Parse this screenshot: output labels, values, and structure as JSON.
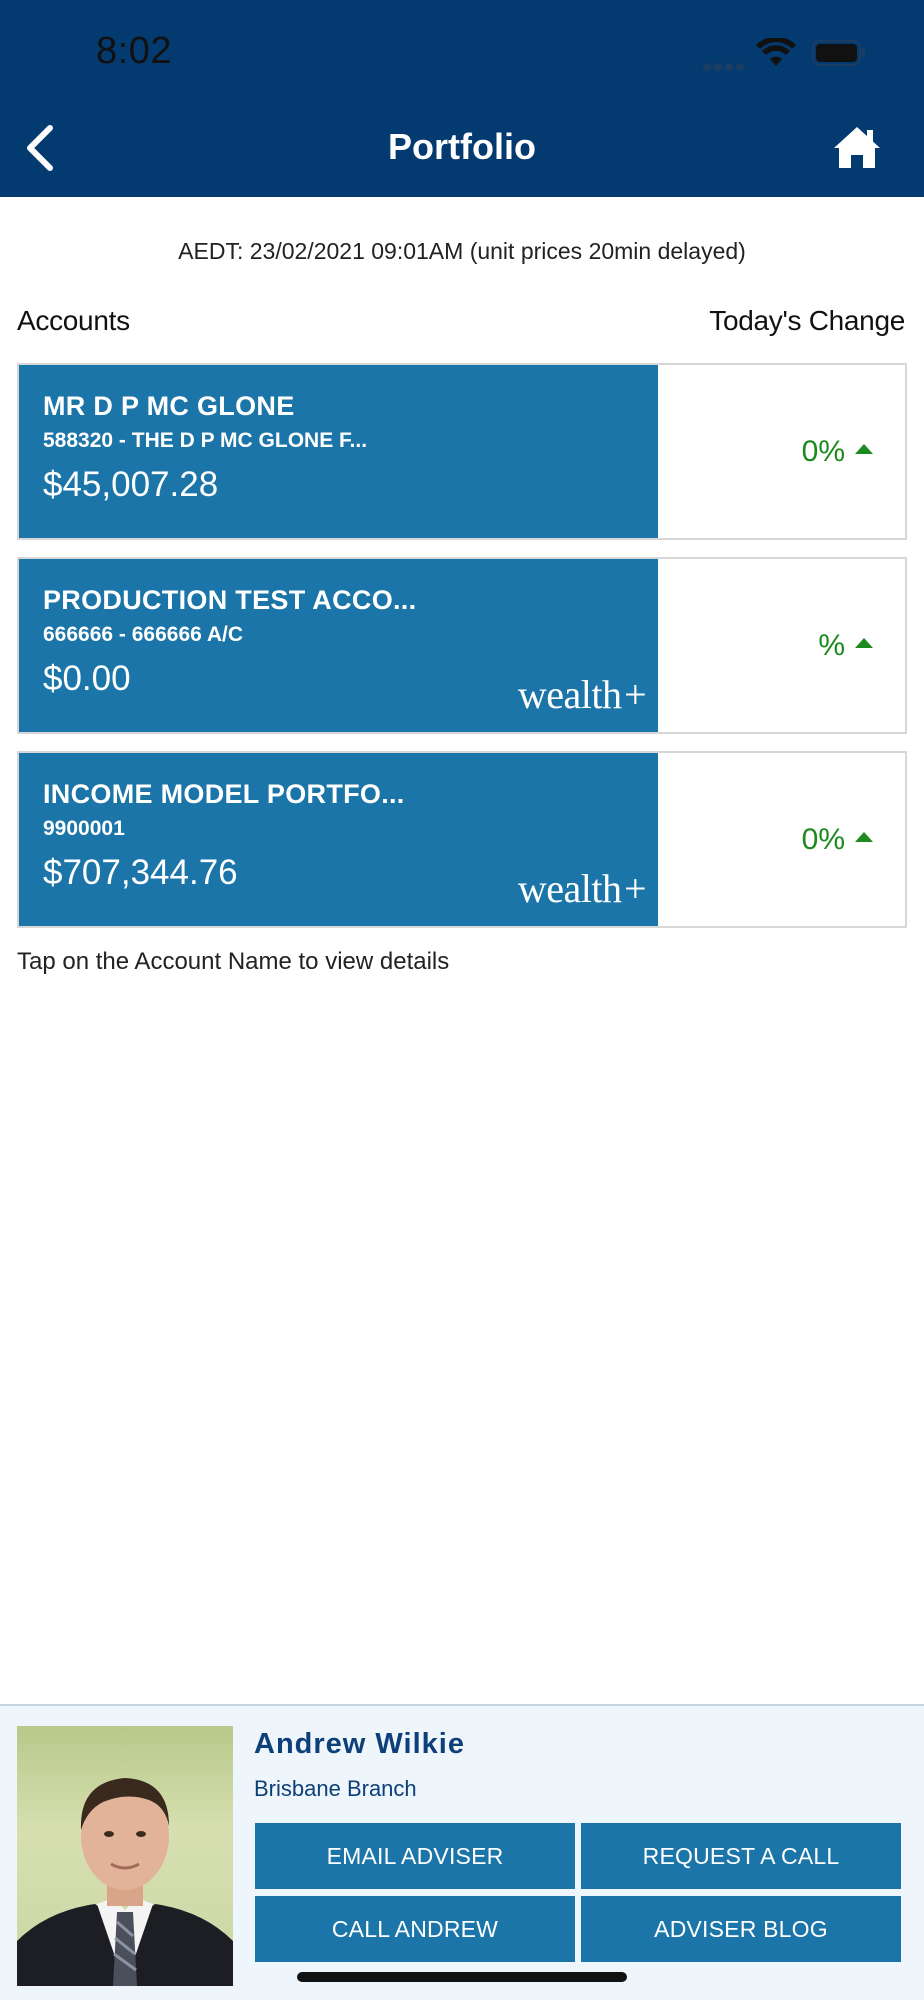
{
  "status_bar": {
    "time": "8:02"
  },
  "nav": {
    "title": "Portfolio",
    "back_icon": "chevron-left-icon",
    "home_icon": "home-icon"
  },
  "timestamp": "AEDT: 23/02/2021 09:01AM (unit prices 20min delayed)",
  "columns": {
    "accounts": "Accounts",
    "change": "Today's Change"
  },
  "accounts": [
    {
      "name": "MR D P MC GLONE",
      "sub": "588320 - THE D P MC GLONE F...",
      "value": "$45,007.28",
      "change": "0%",
      "logo": ""
    },
    {
      "name": "PRODUCTION TEST ACCO...",
      "sub": "666666 - 666666 A/C",
      "value": "$0.00",
      "change": "%",
      "logo": "wealth+"
    },
    {
      "name": "INCOME MODEL PORTFO...",
      "sub": "9900001",
      "value": "$707,344.76",
      "change": "0%",
      "logo": "wealth+"
    }
  ],
  "hint": "Tap on the Account Name to view details",
  "adviser": {
    "name": "Andrew Wilkie",
    "branch": "Brisbane Branch",
    "buttons": {
      "email": "EMAIL ADVISER",
      "request": "REQUEST A CALL",
      "call": "CALL ANDREW",
      "blog": "ADVISER BLOG"
    }
  },
  "colors": {
    "header": "#033a70",
    "card": "#1b75a8",
    "positive": "#1d8a1d",
    "panel": "#eef5fb"
  }
}
